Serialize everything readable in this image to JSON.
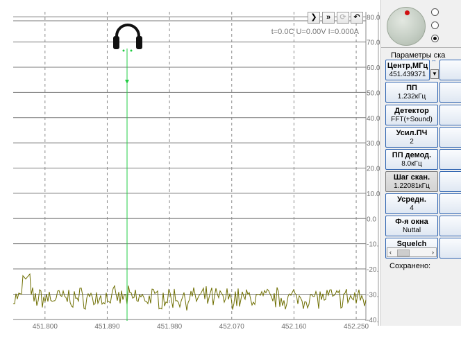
{
  "spectrum": {
    "freq_ticks": [
      451.8,
      451.89,
      451.98,
      452.07,
      452.16,
      452.25
    ],
    "freq_tick_labels": [
      "451.800",
      "451.890",
      "451.980",
      "452.070",
      "452.160",
      "452.250"
    ],
    "db_ticks": [
      80,
      70,
      60,
      50,
      40,
      30,
      20,
      10,
      0,
      -10,
      -20,
      -30,
      -40
    ],
    "db_tick_labels": [
      "80.0",
      "70.0",
      "60.0",
      "50.0",
      "40.0",
      "30.0",
      "20.0",
      "10.0",
      "0.0",
      "-10.",
      "-20.",
      "-30.",
      "-40."
    ],
    "status_text": "t=0.0C U=0.00V I=0.000A",
    "toolbar": [
      {
        "name": "play-icon",
        "glyph": "❯",
        "enabled": true
      },
      {
        "name": "fast-forward-icon",
        "glyph": "»",
        "enabled": true
      },
      {
        "name": "refresh-icon",
        "glyph": "⟳",
        "enabled": false
      },
      {
        "name": "undo-icon",
        "glyph": "↶",
        "enabled": true
      }
    ],
    "marker_icon": "headphones-icon",
    "colors": {
      "trace": "#6e6e00",
      "marker": "#22cc44",
      "grid": "#7a7a7a",
      "dash_grid": "#8a8a8a"
    }
  },
  "panel": {
    "params_label": "Параметры ска",
    "buttons": [
      {
        "id": "center",
        "name": "Центр,МГц",
        "value": "451.439371",
        "pressed": false
      },
      {
        "id": "bandwidth",
        "name": "ПП",
        "value": "1.232кГц",
        "pressed": false
      },
      {
        "id": "detector",
        "name": "Детектор",
        "value": "FFT(+Sound)",
        "pressed": false
      },
      {
        "id": "if-gain",
        "name": "Усил.ПЧ",
        "value": "2",
        "pressed": false
      },
      {
        "id": "demod-bw",
        "name": "ПП демод.",
        "value": "8.0кГц",
        "pressed": false
      },
      {
        "id": "scan-step",
        "name": "Шаг скан.",
        "value": "1.22081кГц",
        "pressed": true
      },
      {
        "id": "averaging",
        "name": "Усредн.",
        "value": "4",
        "pressed": false
      },
      {
        "id": "window",
        "name": "Ф-я окна",
        "value": "Nuttal",
        "pressed": false
      },
      {
        "id": "squelch",
        "name": "Squelch",
        "value": "",
        "pressed": false
      }
    ],
    "saved_label": "Сохранено:"
  }
}
